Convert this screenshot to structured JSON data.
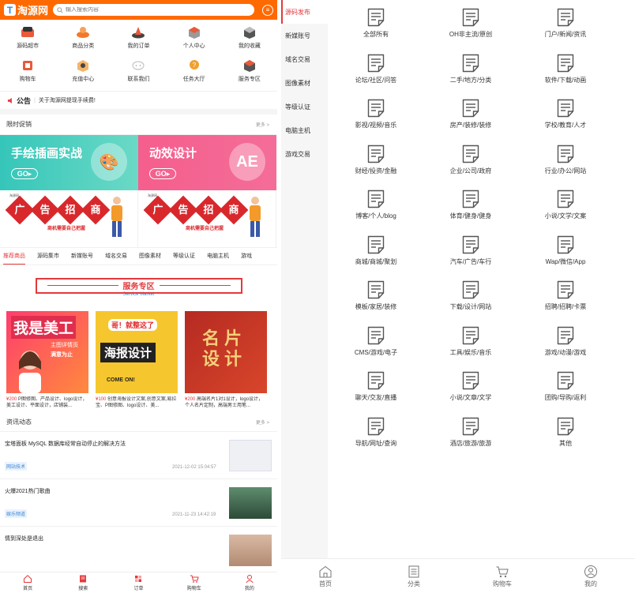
{
  "header": {
    "logo_mark": "T",
    "logo_text": "淘源网",
    "search_placeholder": "输入搜索内容",
    "menu_icon": "menu-icon"
  },
  "quick_grid": [
    {
      "label": "源码超市",
      "icon": "code-box-icon"
    },
    {
      "label": "商品分类",
      "icon": "category-bowl-icon"
    },
    {
      "label": "我的订单",
      "icon": "order-icon"
    },
    {
      "label": "个人中心",
      "icon": "user-box-icon"
    },
    {
      "label": "我的收藏",
      "icon": "favorite-box-icon"
    },
    {
      "label": "购物车",
      "icon": "cart-icon"
    },
    {
      "label": "充值中心",
      "icon": "recharge-icon"
    },
    {
      "label": "联系我们",
      "icon": "chat-icon"
    },
    {
      "label": "任务大厅",
      "icon": "task-icon"
    },
    {
      "label": "服务专区",
      "icon": "service-icon"
    }
  ],
  "notice": {
    "title": "公告",
    "text": "关于淘源网提现手续费!"
  },
  "flash": {
    "title": "限时促销",
    "more": "更多 >"
  },
  "banners": [
    {
      "title": "手绘插画实战",
      "go": "GO",
      "deco": "🎨"
    },
    {
      "title": "动效设计",
      "go": "GO",
      "deco": "AE"
    }
  ],
  "ads": [
    {
      "small": "淘源网",
      "chars": [
        "广",
        "告",
        "招",
        "商"
      ],
      "sub": "商机需要自己把握"
    },
    {
      "small": "淘源网",
      "chars": [
        "广",
        "告",
        "招",
        "商"
      ],
      "sub": "商机需要自己把握"
    }
  ],
  "cat_tabs": [
    "推荐商品",
    "源码集市",
    "新媒账号",
    "域名交易",
    "图像素材",
    "等级认证",
    "电脑主机",
    "游戏"
  ],
  "service": {
    "title": "服务专区",
    "subtitle": "Service Market"
  },
  "products": [
    {
      "img_text": "我是美工",
      "img_sub": "主图详情页",
      "img_sub2": "满意为止",
      "price": "¥200",
      "desc": "P图修图、产品设计、logo设计，美工设计、平面设计，店铺装..."
    },
    {
      "img_text": "海报设计",
      "img_sub": "哥！就整这了",
      "img_sub2": "COME ON!",
      "price": "¥100",
      "desc": "创意海报设计文案,创意文案,易拉宝、P图修图、logo设计、美..."
    },
    {
      "img_text": "名片设计",
      "img_sub": "",
      "img_sub2": "",
      "price": "¥200",
      "desc": "高端名片1对1设计，logo设计，个人名片定制，高端男士用笔..."
    }
  ],
  "news_section": {
    "title": "资讯动态",
    "more": "更多 >"
  },
  "news": [
    {
      "title": "宝塔面板 MySQL 数据库经常自动停止的解决方法",
      "tag": "网站技术",
      "date": "2021-12-02 15:04:57"
    },
    {
      "title": "火爆2021热门歌曲",
      "tag": "娱乐频道",
      "date": "2021-11-23 14:42:19"
    },
    {
      "title": "情到深处是退出",
      "tag": "",
      "date": ""
    }
  ],
  "left_tabbar": [
    {
      "label": "首页",
      "icon": "home-icon"
    },
    {
      "label": "搜索",
      "icon": "search-icon"
    },
    {
      "label": "订单",
      "icon": "order-icon"
    },
    {
      "label": "购物车",
      "icon": "cart-icon"
    },
    {
      "label": "我的",
      "icon": "user-icon"
    }
  ],
  "right_side": [
    "源码发布",
    "新媒账号",
    "域名交易",
    "图像素材",
    "等级认证",
    "电脑主机",
    "游戏交易"
  ],
  "right_grid": [
    "全部所有",
    "OH非主流/原创",
    "门户/新闻/资讯",
    "论坛/社区/问答",
    "二手/地方/分类",
    "软件/下载/动画",
    "影视/视频/音乐",
    "房产/装修/装修",
    "学校/教育/人才",
    "财经/投资/金融",
    "企业/公司/政府",
    "行业/办公/网站",
    "博客/个人/blog",
    "体育/健身/健身",
    "小说/文学/文案",
    "商城/商城/聚划",
    "汽车/广告/车行",
    "Wap/微信/App",
    "模板/家居/装修",
    "下载/设计/网站",
    "招聘/招聘/卡票",
    "CMS/游戏/电子",
    "工具/娱乐/音乐",
    "游戏/动漫/游戏",
    "聊天/交友/直播",
    "小说/文章/文学",
    "团购/导购/返利",
    "导航/网址/查询",
    "酒店/旅游/旅游",
    "其他"
  ],
  "right_tabbar": [
    {
      "label": "首页",
      "icon": "home-icon"
    },
    {
      "label": "分类",
      "icon": "list-icon"
    },
    {
      "label": "购物车",
      "icon": "cart-icon"
    },
    {
      "label": "我的",
      "icon": "user-icon"
    }
  ],
  "colors": {
    "brand": "#ff6a00",
    "accent": "#e4393c",
    "link": "#3a84d6"
  }
}
